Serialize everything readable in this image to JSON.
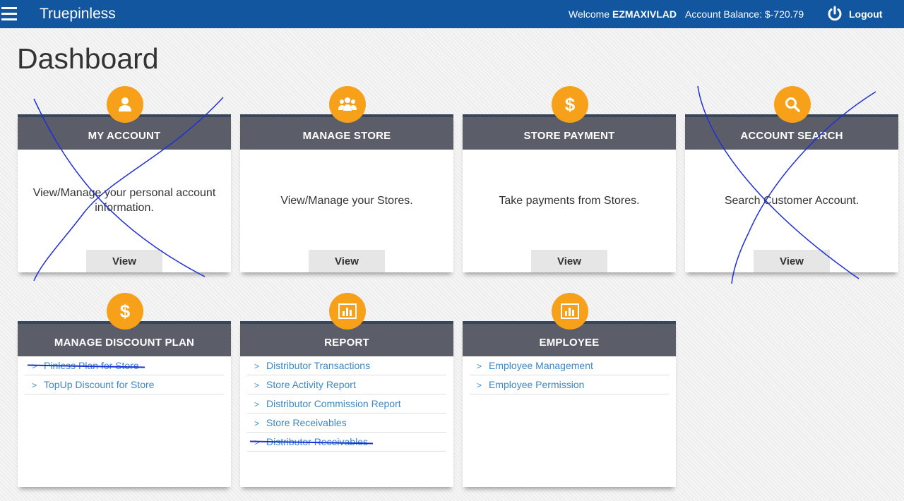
{
  "app": {
    "brand": "Truepinless"
  },
  "header": {
    "welcome_prefix": "Welcome",
    "username": "EZMAXIVLAD",
    "balance_label": "Account Balance: $-720.79",
    "logout_label": "Logout"
  },
  "page": {
    "title": "Dashboard"
  },
  "cards": {
    "my_account": {
      "title": "MY ACCOUNT",
      "desc": "View/Manage your personal account information.",
      "button": "View"
    },
    "manage_store": {
      "title": "MANAGE STORE",
      "desc": "View/Manage your Stores.",
      "button": "View"
    },
    "store_payment": {
      "title": "STORE PAYMENT",
      "desc": "Take payments from Stores.",
      "button": "View"
    },
    "account_search": {
      "title": "ACCOUNT SEARCH",
      "desc": "Search Customer Account.",
      "button": "View"
    },
    "discount_plan": {
      "title": "MANAGE DISCOUNT PLAN",
      "links": [
        "Pinless Plan for Store",
        "TopUp Discount for Store"
      ]
    },
    "report": {
      "title": "REPORT",
      "links": [
        "Distributor Transactions",
        "Store Activity Report",
        "Distributor Commission Report",
        "Store Receivables",
        "Distributor Receivables"
      ]
    },
    "employee": {
      "title": "EMPLOYEE",
      "links": [
        "Employee Management",
        "Employee Permission"
      ]
    }
  },
  "colors": {
    "topbar": "#1256a0",
    "badge": "#f7a11a",
    "card_header": "#5b5e69",
    "link": "#3b89c9",
    "pen": "#1f2fd6"
  },
  "icons": {
    "menu": "hamburger-icon",
    "logout": "power-icon",
    "my_account": "user-icon",
    "manage_store": "group-icon",
    "store_payment": "dollar-icon",
    "account_search": "search-icon",
    "discount_plan": "dollar-icon",
    "report": "bar-chart-icon",
    "employee": "bar-chart-icon"
  }
}
